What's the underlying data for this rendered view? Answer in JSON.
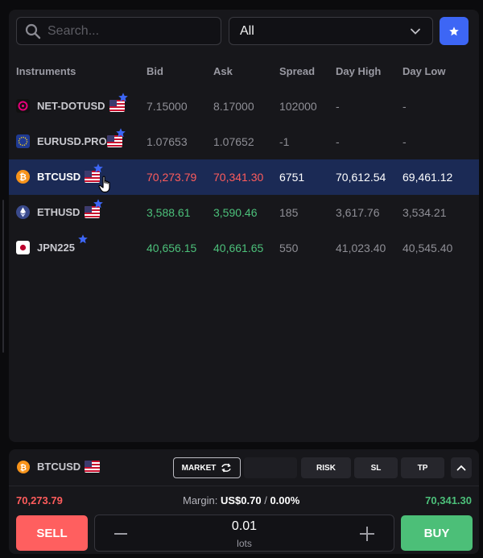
{
  "search": {
    "placeholder": "Search..."
  },
  "filter": {
    "selected": "All"
  },
  "columns": [
    "Instruments",
    "Bid",
    "Ask",
    "Spread",
    "Day High",
    "Day Low"
  ],
  "rows": [
    {
      "name": "NET-DOTUSD",
      "bid": "7.15000",
      "ask": "8.17000",
      "spread": "102000",
      "high": "-",
      "low": "-",
      "icon": "polkadot-icon",
      "flag": "us-flag-icon"
    },
    {
      "name": "EURUSD.PRO",
      "bid": "1.07653",
      "ask": "1.07652",
      "spread": "-1",
      "high": "-",
      "low": "-",
      "icon": "eu-flag-icon",
      "flag": "us-flag-icon"
    },
    {
      "name": "BTCUSD",
      "bid": "70,273.79",
      "ask": "70,341.30",
      "spread": "6751",
      "high": "70,612.54",
      "low": "69,461.12",
      "icon": "bitcoin-icon",
      "flag": "us-flag-icon"
    },
    {
      "name": "ETHUSD",
      "bid": "3,588.61",
      "ask": "3,590.46",
      "spread": "185",
      "high": "3,617.76",
      "low": "3,534.21",
      "icon": "ethereum-icon",
      "flag": "us-flag-icon"
    },
    {
      "name": "JPN225",
      "bid": "40,656.15",
      "ask": "40,661.65",
      "spread": "550",
      "high": "41,023.40",
      "low": "40,545.40",
      "icon": "japan-flag-icon"
    }
  ],
  "colors": {
    "accent": "#3d66f5",
    "sell": "#ff5f5f",
    "buy": "#4cbf78",
    "selected_row": "#1b2a55"
  },
  "trade": {
    "instrument": "BTCUSD",
    "order_type": "MARKET",
    "risk_label": "RISK",
    "sl_label": "SL",
    "tp_label": "TP",
    "bid": "70,273.79",
    "ask": "70,341.30",
    "margin_label": "Margin:",
    "margin_value": "US$0.70",
    "margin_sep": "/",
    "margin_pct": "0.00%",
    "sell_label": "SELL",
    "buy_label": "BUY",
    "lots_value": "0.01",
    "lots_unit": "lots"
  }
}
